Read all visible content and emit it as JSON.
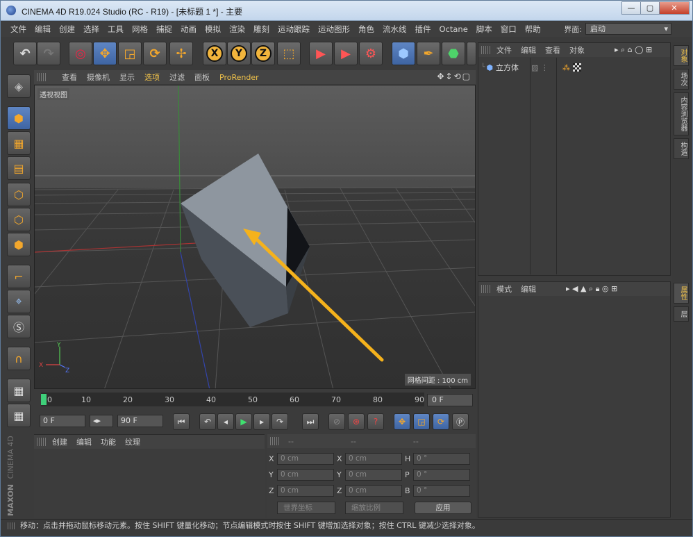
{
  "window": {
    "title": "CINEMA 4D R19.024 Studio (RC - R19) - [未标题 1 *] - 主要",
    "min": "—",
    "max": "▢",
    "close": "✕"
  },
  "menu": [
    "文件",
    "编辑",
    "创建",
    "选择",
    "工具",
    "网格",
    "捕捉",
    "动画",
    "模拟",
    "渲染",
    "雕刻",
    "运动跟踪",
    "运动图形",
    "角色",
    "流水线",
    "插件",
    "Octane",
    "脚本",
    "窗口",
    "帮助"
  ],
  "layout": {
    "label": "界面:",
    "value": "启动"
  },
  "viewport": {
    "menu": [
      "查看",
      "摄像机",
      "显示",
      "选项",
      "过滤",
      "面板",
      "ProRender"
    ],
    "label": "透视视图",
    "grid_info": "网格间距 : 100 cm",
    "axis_x": "X",
    "axis_y": "Y",
    "axis_z": "Z"
  },
  "timeline": {
    "ticks": [
      "0",
      "10",
      "20",
      "30",
      "40",
      "50",
      "60",
      "70",
      "80",
      "90"
    ],
    "current_frame": "0 F"
  },
  "playback": {
    "start": "0 F",
    "end": "90 F"
  },
  "material": {
    "menu": [
      "创建",
      "编辑",
      "功能",
      "纹理"
    ]
  },
  "coords": {
    "headers": [
      "--",
      "--",
      "--"
    ],
    "rows": [
      {
        "a": "X",
        "av": "0 cm",
        "b": "X",
        "bv": "0 cm",
        "c": "H",
        "cv": "0 °"
      },
      {
        "a": "Y",
        "av": "0 cm",
        "b": "Y",
        "bv": "0 cm",
        "c": "P",
        "cv": "0 °"
      },
      {
        "a": "Z",
        "av": "0 cm",
        "b": "Z",
        "bv": "0 cm",
        "c": "B",
        "cv": "0 °"
      }
    ],
    "world": "世界坐标",
    "scale": "缩放比例",
    "apply": "应用"
  },
  "objects": {
    "menu": [
      "文件",
      "编辑",
      "查看",
      "对象"
    ],
    "item": "立方体"
  },
  "attributes": {
    "menu": [
      "模式",
      "编辑"
    ]
  },
  "sidetabs": {
    "objects": "对象",
    "takes": "场次",
    "content": "内容浏览器",
    "structure": "构造",
    "attributes": "属性",
    "layers": "层"
  },
  "status": "移动：点击并拖动鼠标移动元素。按住 SHIFT 键量化移动；节点编辑模式时按住 SHIFT 键增加选择对象；按住 CTRL 键减少选择对象。",
  "brand": {
    "maxon": "MAXON",
    "c4d": "CINEMA 4D"
  },
  "colors": {
    "accent": "#f0c24a",
    "arrow": "#f5b21c",
    "cube": "#7d8793"
  }
}
